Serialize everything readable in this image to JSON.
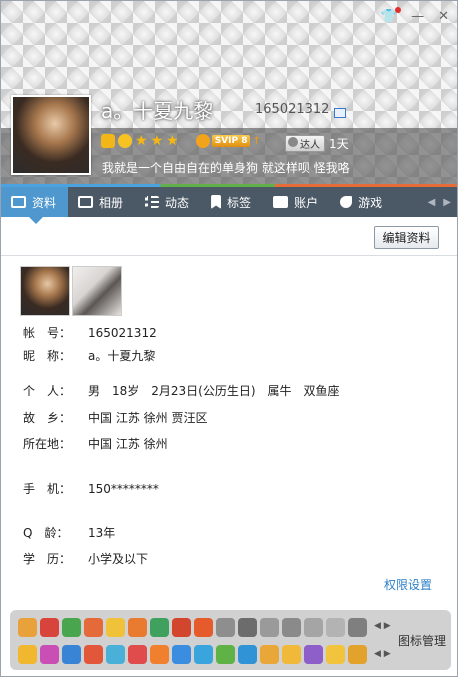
{
  "window": {
    "title_icons": [
      "shirt-icon",
      "minimize-icon",
      "close-icon"
    ]
  },
  "profile": {
    "nickname": "a。十夏九黎",
    "qq_number": "165021312",
    "signature": "我就是一个自由自在的单身狗 就这样呗 怪我咯",
    "svip_label": "SVIP 8",
    "talent_label": "达人",
    "talent_days": "1天"
  },
  "tabs": [
    {
      "label": "资料",
      "icon": "profile-card-icon",
      "active": true
    },
    {
      "label": "相册",
      "icon": "photo-album-icon",
      "active": false
    },
    {
      "label": "动态",
      "icon": "feed-list-icon",
      "active": false
    },
    {
      "label": "标签",
      "icon": "bookmark-icon",
      "active": false
    },
    {
      "label": "账户",
      "icon": "wallet-icon",
      "active": false
    },
    {
      "label": "游戏",
      "icon": "rocket-icon",
      "active": false
    }
  ],
  "edit_button": "编辑资料",
  "details": [
    {
      "label": "帐　号：",
      "value": "165021312"
    },
    {
      "label": "昵　称：",
      "value": "a。十夏九黎"
    },
    {
      "label": "个　人：",
      "value": "男　18岁　2月23日(公历生日)　属牛　双鱼座"
    },
    {
      "label": "故　乡：",
      "value": "中国 江苏 徐州 贾汪区"
    },
    {
      "label": "所在地：",
      "value": "中国 江苏 徐州"
    },
    {
      "label": "手　机：",
      "value": "150********"
    },
    {
      "label": "Q　龄：",
      "value": "13年"
    },
    {
      "label": "学　历：",
      "value": "小学及以下"
    }
  ],
  "permission_link": "权限设置",
  "icon_manage_label": "图标管理",
  "colors": {
    "tab_active": "#4f98cf",
    "tabbar": "#4b5866",
    "link": "#2d7fc9"
  }
}
